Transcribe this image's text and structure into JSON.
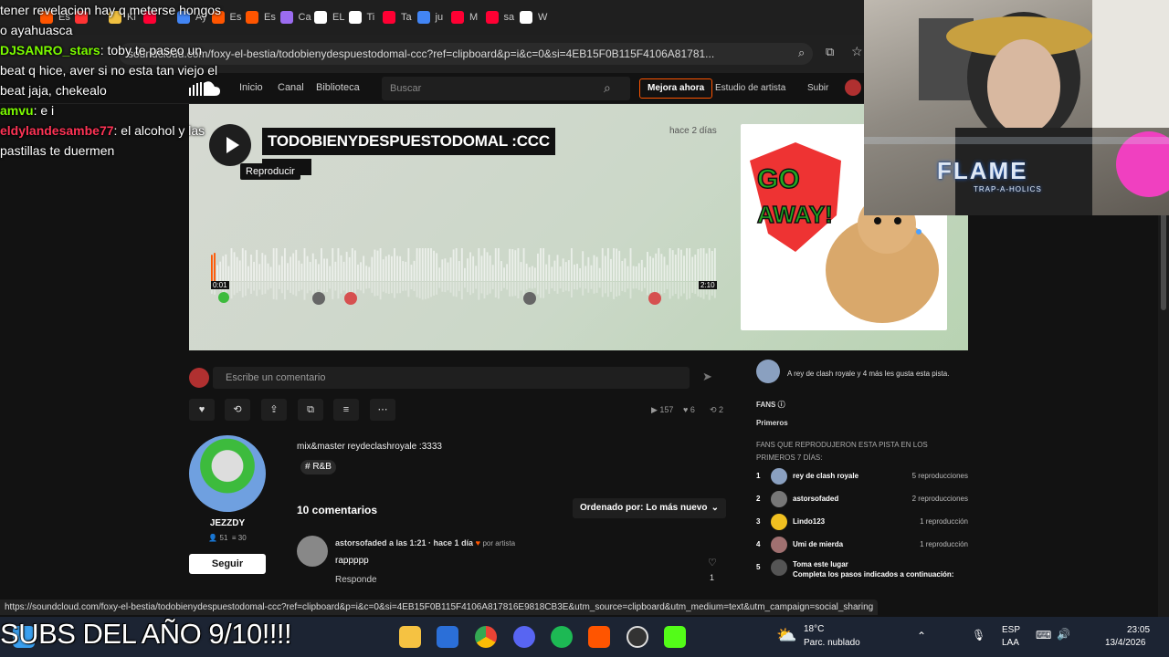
{
  "browser": {
    "tabs": [
      {
        "label": "Es",
        "color": "#ff5500"
      },
      {
        "label": "",
        "color": "#ff3333"
      },
      {
        "label": "Ki",
        "color": "#f0c040"
      },
      {
        "label": "",
        "color": "#ff0033"
      },
      {
        "label": "Ay",
        "color": "#4285f4"
      },
      {
        "label": "Es",
        "color": "#ff5500"
      },
      {
        "label": "Es",
        "color": "#ff5500"
      },
      {
        "label": "Ca",
        "color": "#9b6cf0"
      },
      {
        "label": "EL",
        "color": "#ffffff"
      },
      {
        "label": "Ti",
        "color": "#ffffff"
      },
      {
        "label": "Ta",
        "color": "#ff0033"
      },
      {
        "label": "ju",
        "color": "#4285f4"
      },
      {
        "label": "M",
        "color": "#ff0033"
      },
      {
        "label": "sa",
        "color": "#ff0033"
      },
      {
        "label": "W",
        "color": "#ffffff"
      }
    ],
    "url": "soundcloud.com/foxy-el-bestia/todobienydespuestodomal-ccc?ref=clipboard&p=i&c=0&si=4EB15F0B115F4106A81781..."
  },
  "sc_header": {
    "nav": [
      "Inicio",
      "Canal",
      "Biblioteca"
    ],
    "search_placeholder": "Buscar",
    "upgrade_label": "Mejora ahora",
    "studio_label": "Estudio de artista",
    "upload_label": "Subir"
  },
  "track": {
    "title": "TODOBIENYDESPUESTODOMAL :CCC",
    "tooltip": "Reproducir",
    "posted": "hace 2 días",
    "time_current": "0:01",
    "time_total": "2:10",
    "progress_fraction": 0.01
  },
  "comment_input_placeholder": "Escribe un comentario",
  "stats": {
    "plays": "157",
    "likes": "6",
    "reposts": "2"
  },
  "artist": {
    "name": "JEZZDY",
    "followers": "51",
    "tracks": "30",
    "follow_label": "Seguir"
  },
  "description": "mix&master reydeclashroyale :3333",
  "genre_tag": "# R&B",
  "comments": {
    "count_label": "10 comentarios",
    "sort_label": "Ordenado por: Lo más nuevo",
    "first": {
      "author": "astorsofaded a las 1:21 · hace 1 día",
      "badge": "por artista",
      "text": "rappppp",
      "reply_label": "Responde",
      "likes": "1"
    }
  },
  "right_col": {
    "likers_text": "A rey de clash royale y 4 más les gusta esta pista.",
    "fans_label": "FANS",
    "first_label": "Primeros",
    "early_fans_caption": "FANS QUE REPRODUJERON ESTA PISTA EN LOS PRIMEROS 7 DÍAS:",
    "fans": [
      {
        "rank": "1",
        "name": "rey de clash royale",
        "plays": "5 reproducciones"
      },
      {
        "rank": "2",
        "name": "astorsofaded",
        "plays": "2 reproducciones"
      },
      {
        "rank": "3",
        "name": "Lindo123",
        "plays": "1 reproducción"
      },
      {
        "rank": "4",
        "name": "Umi de mierda",
        "plays": "1 reproducción"
      }
    ],
    "slot5": {
      "rank": "5",
      "name": "Toma este lugar",
      "sub": "Completa los pasos indicados a continuación:"
    }
  },
  "chat": [
    {
      "user": "",
      "text": "tener revelacion hay q meterse hongos o ayahuasca",
      "color": "#ffffff"
    },
    {
      "user": "DJSANRO_stars",
      "text": ": toby te paseo un beat q hice, aver si no esta tan viejo el beat jaja, chekealo",
      "color": "#7CFC00"
    },
    {
      "user": "amvu",
      "text": ": e i",
      "color": "#7CFC00"
    },
    {
      "user": "eldylandesambe77",
      "text": ": el alcohol y las pastillas te duermen",
      "color": "#ff3355"
    }
  ],
  "overlay": {
    "webcam_brand": "FLAME",
    "webcam_brand_sub": "TRAP-A-HOLICS",
    "status_url": "https://soundcloud.com/foxy-el-bestia/todobienydespuestodomal-ccc?ref=clipboard&p=i&c=0&si=4EB15F0B115F4106A817816E9818CB3E&utm_source=clipboard&utm_medium=text&utm_campaign=social_sharing",
    "subs_caption": "SUBS DEL AÑO 9/10!!!!"
  },
  "taskbar": {
    "weather_temp": "18°C",
    "weather_desc": "Parc. nublado",
    "lang": "ESP",
    "lang_sub": "LAA",
    "time": "23:05",
    "date": "13/4/2026"
  }
}
